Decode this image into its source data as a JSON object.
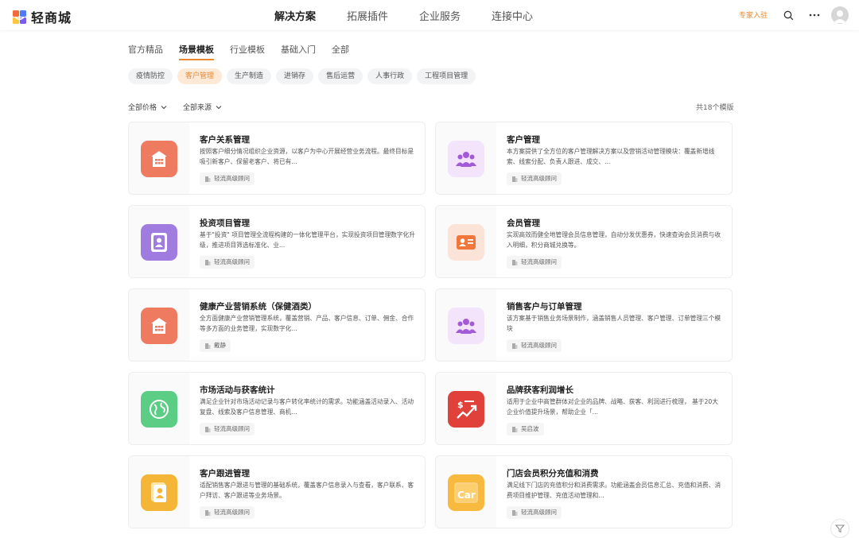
{
  "brand": {
    "name": "轻商城"
  },
  "nav": [
    {
      "label": "解决方案",
      "active": true
    },
    {
      "label": "拓展插件",
      "active": false
    },
    {
      "label": "企业服务",
      "active": false
    },
    {
      "label": "连接中心",
      "active": false
    }
  ],
  "header": {
    "expert_label": "专家入驻"
  },
  "tabs": [
    {
      "label": "官方精品",
      "active": false
    },
    {
      "label": "场景模板",
      "active": true
    },
    {
      "label": "行业模板",
      "active": false
    },
    {
      "label": "基础入门",
      "active": false
    },
    {
      "label": "全部",
      "active": false
    }
  ],
  "pills": [
    {
      "label": "疫情防控",
      "active": false
    },
    {
      "label": "客户管理",
      "active": true
    },
    {
      "label": "生产制造",
      "active": false
    },
    {
      "label": "进销存",
      "active": false
    },
    {
      "label": "售后运营",
      "active": false
    },
    {
      "label": "人事行政",
      "active": false
    },
    {
      "label": "工程项目管理",
      "active": false
    }
  ],
  "filters": {
    "price": "全部价格",
    "source": "全部来源",
    "count_text": "共18个模版"
  },
  "colors": {
    "accent": "#e8892f"
  },
  "cards": [
    {
      "title": "客户关系管理",
      "desc": "按照客户细分情况组织企业资源，以客户为中心开展经营业务流程。最终目标是吸引新客户、保留老客户、将已有...",
      "tag": "轻流高级顾问",
      "icon": "building-icon",
      "icon_bg": "#ee7b5f"
    },
    {
      "title": "客户管理",
      "desc": "本方案提供了全方位的客户管理解决方案以及营销活动管理模块：覆盖新增线索、线索分配、负责人跟进、成交、...",
      "tag": "轻流高级顾问",
      "icon": "people-icon",
      "icon_bg": "#f3e4fb"
    },
    {
      "title": "投资项目管理",
      "desc": "基于\"投资\" 项目管理全流程构建的一体化管理平台，实现投资项目管理数字化升级，推进项目筛选标准化、业...",
      "tag": "轻流高级顾问",
      "icon": "contact-card-icon",
      "icon_bg": "#a07be0"
    },
    {
      "title": "会员管理",
      "desc": "实现高效而健全地管理会员信息管理，自动分发优惠券，快速查询会员消费与收入明细，积分商城兑换等。",
      "tag": "轻流高级顾问",
      "icon": "id-card-icon",
      "icon_bg": "#fbe3d8"
    },
    {
      "title": "健康产业营销系统（保健酒类）",
      "desc": "全方面健康产业营销管理系统，覆盖营销、产品、客户信息、订单、佣金、合作等多方面的业务管理，实现数字化...",
      "tag": "戴静",
      "icon": "building-icon",
      "icon_bg": "#ee7b5f"
    },
    {
      "title": "销售客户与订单管理",
      "desc": "该方案基于销售业务场景制作，涵盖销售人员管理、客户管理、订单管理三个模块",
      "tag": "轻流高级顾问",
      "icon": "people-icon",
      "icon_bg": "#f3e4fb"
    },
    {
      "title": "市场活动与获客统计",
      "desc": "满足企业针对市场活动记录与客户转化率统计的需求。功能涵盖活动录入、活动复盘、线索及客户信息管理、商机...",
      "tag": "轻流高级顾问",
      "icon": "globe-icon",
      "icon_bg": "#5ccd84"
    },
    {
      "title": "品牌获客利润增长",
      "desc": "适用于企业中高管群体对企业的品牌、战略、获客、利润进行梳理， 基于20大企业价值提升场景，帮助企业「...",
      "tag": "吴启波",
      "icon": "profit-chart-icon",
      "icon_bg": "#e0413a"
    },
    {
      "title": "客户跟进管理",
      "desc": "适配销售客户跟进与管理的基础系统，覆盖客户信息录入与查看，客户联系、客户拜访、客户跟进等业务场景。",
      "tag": "轻流高级顾问",
      "icon": "contact-book-icon",
      "icon_bg": "#f5b638"
    },
    {
      "title": "门店会员积分充值和消费",
      "desc": "满足线下门店的充值积分和消费需求。功能涵盖会员信息汇总、充值和消费、消费项目维护管理、充值活动管理和...",
      "tag": "轻流高级顾问",
      "icon": "car-icon",
      "icon_bg": "#f7b93e"
    }
  ]
}
